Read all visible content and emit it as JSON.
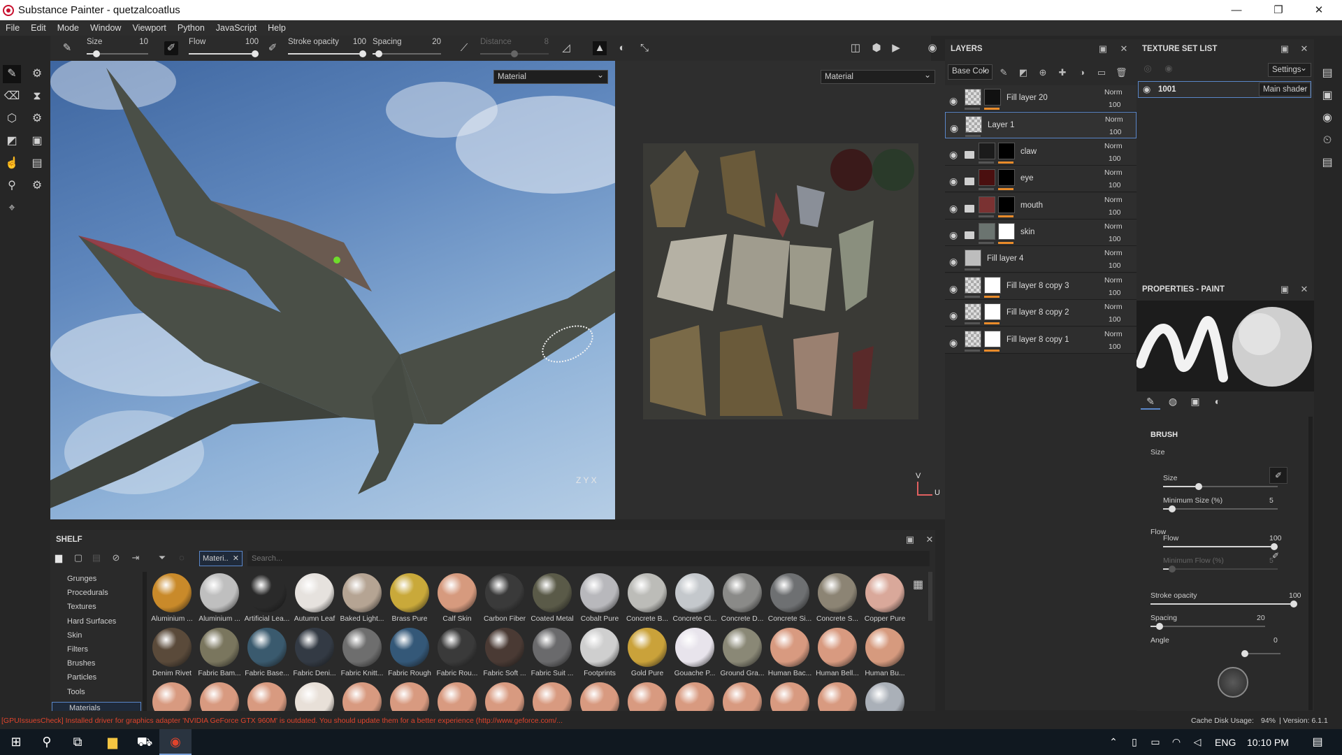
{
  "window": {
    "title": "Substance Painter - quetzalcoatlus",
    "minimize": "—",
    "maximize": "❐",
    "close": "✕"
  },
  "menu": [
    "File",
    "Edit",
    "Mode",
    "Window",
    "Viewport",
    "Python",
    "JavaScript",
    "Help"
  ],
  "toolbar": {
    "size": {
      "label": "Size",
      "value": "10",
      "fraction": 0.12
    },
    "flow": {
      "label": "Flow",
      "value": "100",
      "fraction": 1.0
    },
    "stroke_opacity": {
      "label": "Stroke opacity",
      "value": "100",
      "fraction": 1.0
    },
    "spacing": {
      "label": "Spacing",
      "value": "20",
      "fraction": 0.05
    },
    "distance": {
      "label": "Distance",
      "value": "8",
      "fraction": 0.5
    }
  },
  "viewport": {
    "left_mode": "Material",
    "right_mode": "Material",
    "gizmo_left": "Z  Y  X",
    "gizmo_right_v": "V",
    "gizmo_right_u": "U"
  },
  "layers_panel": {
    "title": "LAYERS",
    "channel": "Base Colo",
    "rows": [
      {
        "name": "Fill layer 20",
        "mode": "Norm",
        "opacity": "100",
        "kind": "fill",
        "th1": "checker",
        "th2": "#111",
        "sel": false
      },
      {
        "name": "Layer 1",
        "mode": "Norm",
        "opacity": "100",
        "kind": "paint",
        "th1": "checker",
        "th2": "",
        "sel": true
      },
      {
        "name": "claw",
        "mode": "Norm",
        "opacity": "100",
        "kind": "folder",
        "th1": "#1b1b1b",
        "th2": "#000",
        "sel": false
      },
      {
        "name": "eye",
        "mode": "Norm",
        "opacity": "100",
        "kind": "folder",
        "th1": "#4a0f0f",
        "th2": "#000",
        "sel": false
      },
      {
        "name": "mouth",
        "mode": "Norm",
        "opacity": "100",
        "kind": "folder",
        "th1": "#7a3232",
        "th2": "#000",
        "sel": false
      },
      {
        "name": "skin",
        "mode": "Norm",
        "opacity": "100",
        "kind": "folder",
        "th1": "#6b7470",
        "th2": "#fff",
        "sel": false
      },
      {
        "name": "Fill layer 4",
        "mode": "Norm",
        "opacity": "100",
        "kind": "paint",
        "th1": "#bdbdbd",
        "th2": "",
        "sel": false
      },
      {
        "name": "Fill layer 8 copy 3",
        "mode": "Norm",
        "opacity": "100",
        "kind": "fill",
        "th1": "checker",
        "th2": "#fff",
        "sel": false
      },
      {
        "name": "Fill layer 8 copy 2",
        "mode": "Norm",
        "opacity": "100",
        "kind": "fill",
        "th1": "checker",
        "th2": "#fff",
        "sel": false
      },
      {
        "name": "Fill layer 8 copy 1",
        "mode": "Norm",
        "opacity": "100",
        "kind": "fill",
        "th1": "checker",
        "th2": "#fff",
        "sel": false
      }
    ]
  },
  "texture_set_list": {
    "title": "TEXTURE SET LIST",
    "settings": "Settings",
    "item": "1001",
    "shader": "Main shader"
  },
  "properties": {
    "title": "PROPERTIES - PAINT",
    "section": "BRUSH",
    "group_size": "Size",
    "group_flow": "Flow",
    "sliders": [
      {
        "id": "size",
        "label": "Size",
        "value": "10",
        "fraction": 0.3,
        "dim": false
      },
      {
        "id": "min_size",
        "label": "Minimum Size (%)",
        "value": "5",
        "fraction": 0.05,
        "dim": false
      },
      {
        "id": "flow",
        "label": "Flow",
        "value": "100",
        "fraction": 1.0,
        "dim": false
      },
      {
        "id": "min_flow",
        "label": "Minimum Flow (%)",
        "value": "5",
        "fraction": 0.05,
        "dim": true
      },
      {
        "id": "stroke_opacity",
        "label": "Stroke opacity",
        "value": "100",
        "fraction": 1.0,
        "dim": false
      },
      {
        "id": "spacing",
        "label": "Spacing",
        "value": "20",
        "fraction": 0.05,
        "dim": false
      },
      {
        "id": "angle",
        "label": "Angle",
        "value": "0",
        "fraction": 0.0,
        "dim": false
      }
    ]
  },
  "shelf": {
    "title": "SHELF",
    "filter_tag": "Materi..",
    "search_placeholder": "Search...",
    "categories": [
      "Grunges",
      "Procedurals",
      "Textures",
      "Hard Surfaces",
      "Skin",
      "Filters",
      "Brushes",
      "Particles",
      "Tools",
      "Materials"
    ],
    "selected_category": "Materials",
    "materials_row1": [
      {
        "name": "Aluminium ...",
        "color": "#c98a2a"
      },
      {
        "name": "Aluminium ...",
        "color": "#bfbfbf"
      },
      {
        "name": "Artificial Lea...",
        "color": "#2a2a2a"
      },
      {
        "name": "Autumn Leaf",
        "color": "#e6e2de"
      },
      {
        "name": "Baked Light...",
        "color": "#b5a493"
      },
      {
        "name": "Brass Pure",
        "color": "#c9a93a"
      },
      {
        "name": "Calf Skin",
        "color": "#d69a7e"
      },
      {
        "name": "Carbon Fiber",
        "color": "#3a3a3a"
      },
      {
        "name": "Coated Metal",
        "color": "#5a5a48"
      },
      {
        "name": "Cobalt Pure",
        "color": "#b8b8bc"
      },
      {
        "name": "Concrete B...",
        "color": "#bcbcb8"
      },
      {
        "name": "Concrete Cl...",
        "color": "#c4c8cc"
      },
      {
        "name": "Concrete D...",
        "color": "#8a8a88"
      },
      {
        "name": "Concrete Si...",
        "color": "#6e7072"
      },
      {
        "name": "Concrete S...",
        "color": "#8c8474"
      },
      {
        "name": "Copper Pure",
        "color": "#d9a89a"
      }
    ],
    "materials_row2": [
      {
        "name": "Denim Rivet",
        "color": "#5a4a3a"
      },
      {
        "name": "Fabric Bam...",
        "color": "#7a765e"
      },
      {
        "name": "Fabric Base...",
        "color": "#3a5a6e"
      },
      {
        "name": "Fabric Deni...",
        "color": "#333a44"
      },
      {
        "name": "Fabric Knitt...",
        "color": "#6e6e6e"
      },
      {
        "name": "Fabric Rough",
        "color": "#345878"
      },
      {
        "name": "Fabric Rou...",
        "color": "#3a3a3a"
      },
      {
        "name": "Fabric Soft ...",
        "color": "#4a3a34"
      },
      {
        "name": "Fabric Suit ...",
        "color": "#6a6a6c"
      },
      {
        "name": "Footprints",
        "color": "#cfcfcf"
      },
      {
        "name": "Gold Pure",
        "color": "#caa23a"
      },
      {
        "name": "Gouache P...",
        "color": "#e8e4ec"
      },
      {
        "name": "Ground Gra...",
        "color": "#8a8876"
      },
      {
        "name": "Human Bac...",
        "color": "#d89a80"
      },
      {
        "name": "Human Bell...",
        "color": "#d89a80"
      },
      {
        "name": "Human Bu...",
        "color": "#d69a7e"
      }
    ],
    "materials_row3": [
      "#d89a80",
      "#d89a80",
      "#d89a80",
      "#e8e0d8",
      "#d89a80",
      "#d89a80",
      "#d89a80",
      "#d89a80",
      "#d89a80",
      "#d89a80",
      "#d89a80",
      "#d89a80",
      "#d89a80",
      "#d89a80",
      "#d89a80",
      "#aab0b8"
    ]
  },
  "status": {
    "message": "[GPUIssuesCheck] Installed driver for graphics adapter 'NVIDIA GeForce GTX 960M' is outdated. You should update them for a better experience (http://www.geforce.com/...",
    "cache_label": "Cache Disk Usage:",
    "cache_value": "94%",
    "version": "| Version: 6.1.1",
    "message_color": "#e0442c"
  },
  "taskbar": {
    "lang": "ENG",
    "time": "10:10 PM"
  }
}
